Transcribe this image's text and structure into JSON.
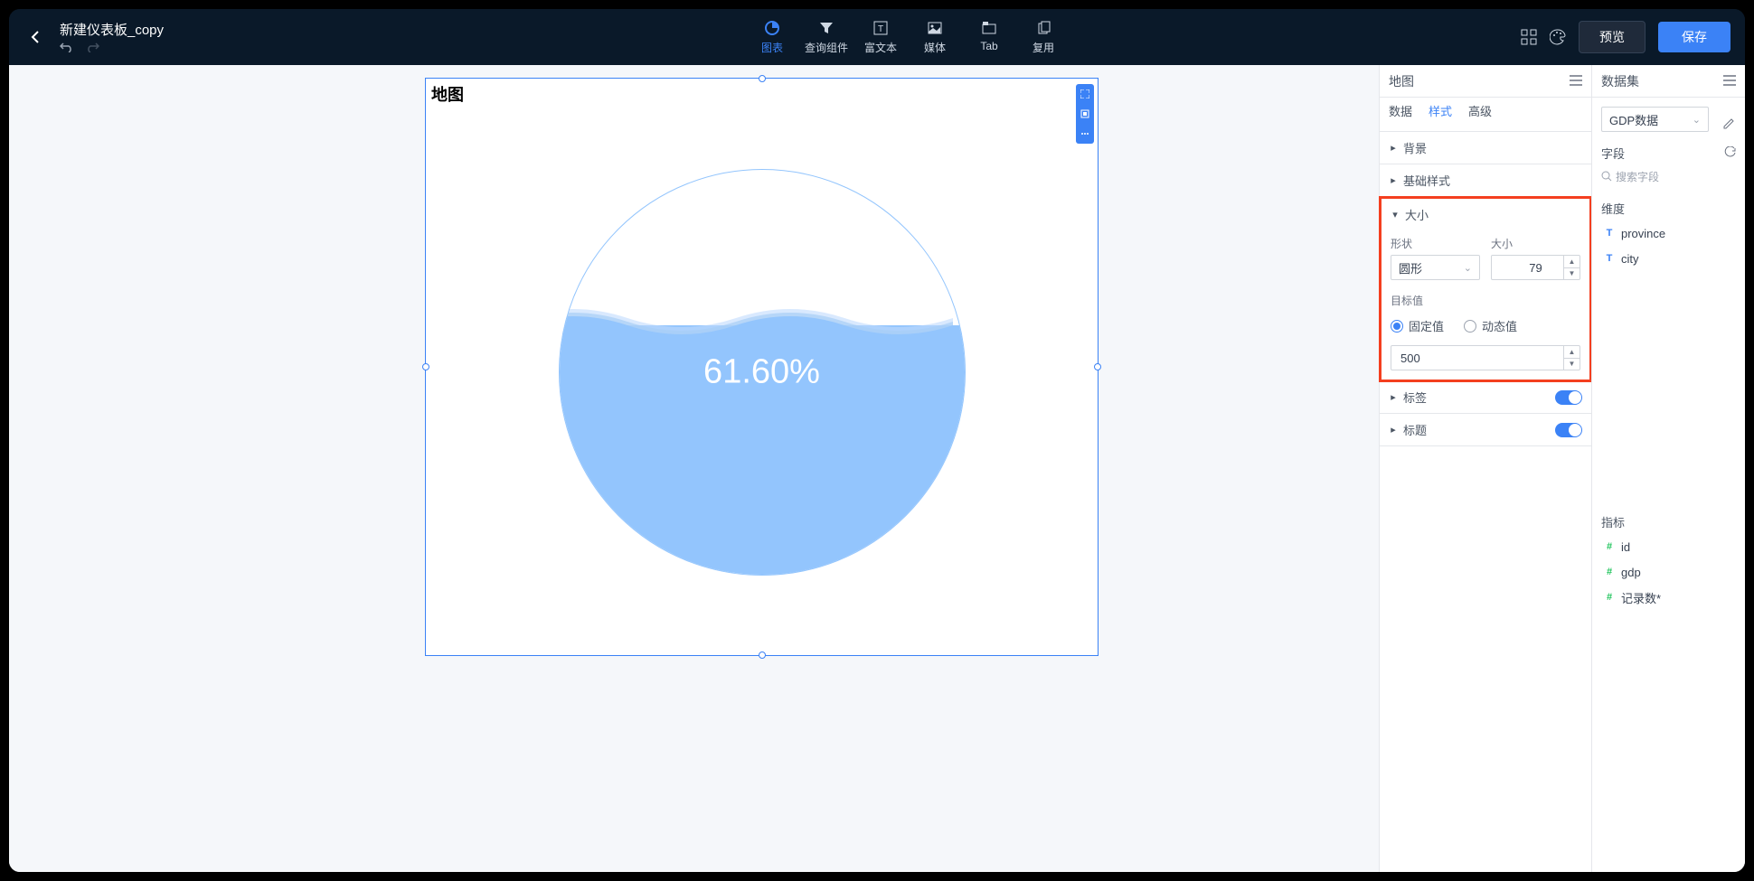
{
  "doc_title": "新建仪表板_copy",
  "toolbar": {
    "items": [
      {
        "label": "图表",
        "icon": "pie"
      },
      {
        "label": "查询组件",
        "icon": "filter"
      },
      {
        "label": "富文本",
        "icon": "text"
      },
      {
        "label": "媒体",
        "icon": "image"
      },
      {
        "label": "Tab",
        "icon": "tab"
      },
      {
        "label": "复用",
        "icon": "copy"
      }
    ],
    "preview": "预览",
    "save": "保存"
  },
  "canvas": {
    "chart_title": "地图"
  },
  "chart_data": {
    "type": "liquidfill",
    "value": 61.6,
    "display": "61.60%",
    "shape": "circle",
    "target": 500
  },
  "style_panel": {
    "title": "地图",
    "tabs": [
      "数据",
      "样式",
      "高级"
    ],
    "active_tab": "样式",
    "sections": {
      "bg": "背景",
      "basic": "基础样式",
      "size": "大小",
      "label": "标签",
      "title": "标题"
    },
    "shape_label": "形状",
    "shape_value": "圆形",
    "size_label": "大小",
    "size_value": "79",
    "target_label": "目标值",
    "fixed": "固定值",
    "dynamic": "动态值",
    "target_value": "500"
  },
  "dataset_panel": {
    "title": "数据集",
    "selected": "GDP数据",
    "field_label": "字段",
    "search_placeholder": "搜索字段",
    "dim_label": "维度",
    "dims": [
      "province",
      "city"
    ],
    "measure_label": "指标",
    "measures": [
      "id",
      "gdp",
      "记录数*"
    ]
  }
}
